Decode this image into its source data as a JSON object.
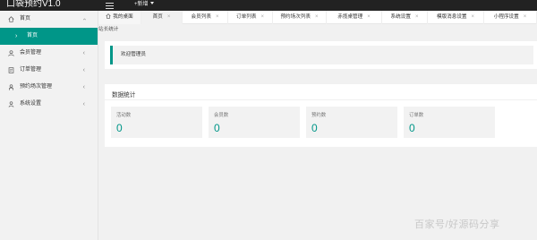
{
  "header": {
    "brand": "口袋预约V1.0",
    "new_label": "+新增"
  },
  "sidebar": {
    "items": [
      {
        "label": "首页",
        "icon": "home-icon",
        "open": true
      },
      {
        "label": "会员管理",
        "icon": "user-icon"
      },
      {
        "label": "订单管理",
        "icon": "order-icon"
      },
      {
        "label": "预约场次管理",
        "icon": "person-icon"
      },
      {
        "label": "系统设置",
        "icon": "settings-icon"
      }
    ],
    "sub_items": [
      {
        "label": "首页"
      }
    ]
  },
  "tabs": [
    {
      "label": "我的桌面"
    },
    {
      "label": "首页"
    },
    {
      "label": "会员列表"
    },
    {
      "label": "订单列表"
    },
    {
      "label": "预约场次列表"
    },
    {
      "label": "赤揽桌管理"
    },
    {
      "label": "系统设置"
    },
    {
      "label": "模版消息设置"
    },
    {
      "label": "小程序设置"
    }
  ],
  "breadcrumb": "站长统计",
  "welcome": "欢迎管理员",
  "stats": {
    "title": "数据统计",
    "items": [
      {
        "label": "活动数",
        "value": "0"
      },
      {
        "label": "会员数",
        "value": "0"
      },
      {
        "label": "预约数",
        "value": "0"
      },
      {
        "label": "订单数",
        "value": "0"
      }
    ]
  },
  "watermark": "百家号/好源码分享",
  "colors": {
    "accent": "#009688",
    "topbar": "#222222"
  }
}
